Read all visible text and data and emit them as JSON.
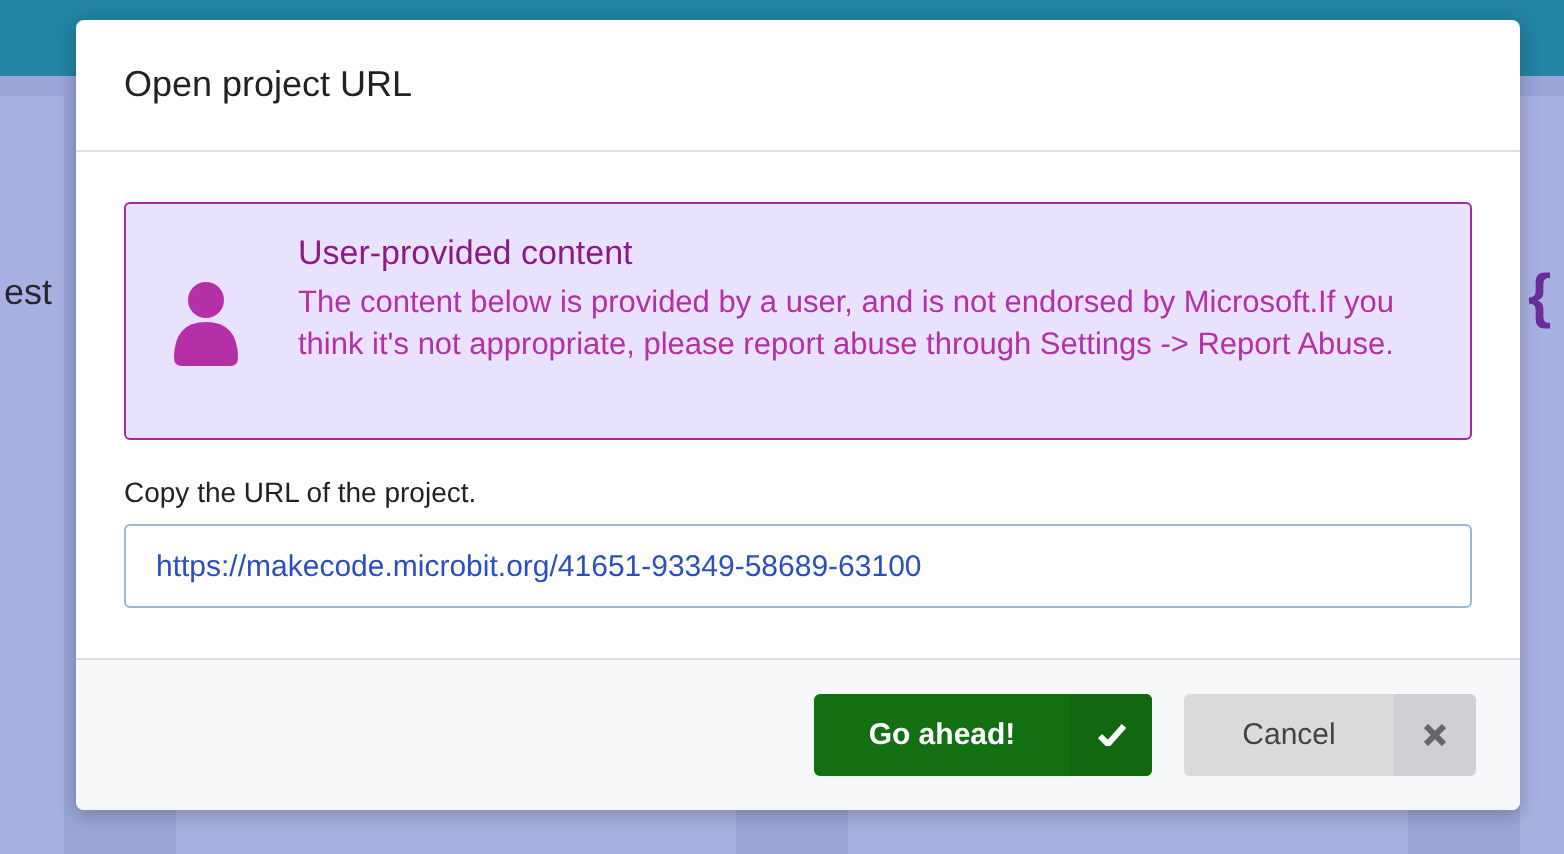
{
  "background": {
    "left_card_text": "est",
    "right_card_glyph": "{"
  },
  "dialog": {
    "title": "Open project URL",
    "notice": {
      "heading": "User-provided content",
      "text": "The content below is provided by a user, and is not endorsed by Microsoft.If you think it's not appropriate, please report abuse through Settings -> Report Abuse."
    },
    "field_label": "Copy the URL of the project.",
    "url_value": "https://makecode.microbit.org/41651-93349-58689-63100",
    "buttons": [
      {
        "label": "Go ahead!",
        "kind": "primary"
      },
      {
        "label": "Cancel",
        "kind": "secondary"
      }
    ]
  }
}
